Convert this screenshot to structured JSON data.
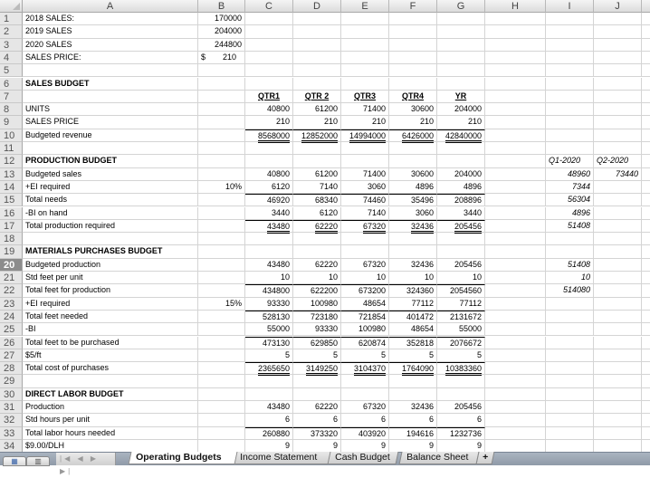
{
  "columns": [
    "A",
    "B",
    "C",
    "D",
    "E",
    "F",
    "G",
    "H",
    "I",
    "J"
  ],
  "rows": [
    {
      "n": "1",
      "A": "2018 SALES:",
      "B": "170000"
    },
    {
      "n": "2",
      "A": "2019 SALES",
      "B": "204000"
    },
    {
      "n": "3",
      "A": "2020 SALES",
      "B": "244800"
    },
    {
      "n": "4",
      "A": "SALES PRICE:",
      "B_dollar": "$",
      "B": "210"
    },
    {
      "n": "5"
    },
    {
      "n": "6",
      "A": "SALES BUDGET",
      "bold": true
    },
    {
      "n": "7",
      "C": "QTR1",
      "D": "QTR 2",
      "E": "QTR3",
      "F": "QTR4",
      "G": "YR",
      "hdr": true
    },
    {
      "n": "8",
      "A": "UNITS",
      "C": "40800",
      "D": "61200",
      "E": "71400",
      "F": "30600",
      "G": "204000"
    },
    {
      "n": "9",
      "A": "SALES PRICE",
      "C": "210",
      "D": "210",
      "E": "210",
      "F": "210",
      "G": "210"
    },
    {
      "n": "10",
      "A": "Budgeted revenue",
      "C": "8568000",
      "D": "12852000",
      "E": "14994000",
      "F": "6426000",
      "G": "42840000",
      "top": true,
      "dbl": true
    },
    {
      "n": "11"
    },
    {
      "n": "12",
      "A": "PRODUCTION BUDGET",
      "bold": true,
      "I": "Q1-2020",
      "J": "Q2-2020",
      "ijleft": true
    },
    {
      "n": "13",
      "A": "Budgeted sales",
      "C": "40800",
      "D": "61200",
      "E": "71400",
      "F": "30600",
      "G": "204000",
      "I": "48960",
      "J": "73440"
    },
    {
      "n": "14",
      "A": "+EI required",
      "B": "10%",
      "C": "6120",
      "D": "7140",
      "E": "3060",
      "F": "4896",
      "G": "4896",
      "I": "7344"
    },
    {
      "n": "15",
      "A": "Total needs",
      "C": "46920",
      "D": "68340",
      "E": "74460",
      "F": "35496",
      "G": "208896",
      "top": true,
      "I": "56304"
    },
    {
      "n": "16",
      "A": "-BI on hand",
      "C": "3440",
      "D": "6120",
      "E": "7140",
      "F": "3060",
      "G": "3440",
      "I": "4896"
    },
    {
      "n": "17",
      "A": "Total production required",
      "C": "43480",
      "D": "62220",
      "E": "67320",
      "F": "32436",
      "G": "205456",
      "top": true,
      "dbl": true,
      "I": "51408"
    },
    {
      "n": "18"
    },
    {
      "n": "19",
      "A": "MATERIALS PURCHASES BUDGET",
      "bold": true
    },
    {
      "n": "20",
      "A": "Budgeted production",
      "C": "43480",
      "D": "62220",
      "E": "67320",
      "F": "32436",
      "G": "205456",
      "I": "51408",
      "sel": true
    },
    {
      "n": "21",
      "A": "Std feet per unit",
      "C": "10",
      "D": "10",
      "E": "10",
      "F": "10",
      "G": "10",
      "I": "10"
    },
    {
      "n": "22",
      "A": "Total feet for production",
      "C": "434800",
      "D": "622200",
      "E": "673200",
      "F": "324360",
      "G": "2054560",
      "top": true,
      "I": "514080"
    },
    {
      "n": "23",
      "A": "+EI required",
      "B": "15%",
      "C": "93330",
      "D": "100980",
      "E": "48654",
      "F": "77112",
      "G": "77112"
    },
    {
      "n": "24",
      "A": "Total feet needed",
      "C": "528130",
      "D": "723180",
      "E": "721854",
      "F": "401472",
      "G": "2131672",
      "top": true
    },
    {
      "n": "25",
      "A": "-BI",
      "C": "55000",
      "D": "93330",
      "E": "100980",
      "F": "48654",
      "G": "55000"
    },
    {
      "n": "26",
      "A": "Total feet to be purchased",
      "C": "473130",
      "D": "629850",
      "E": "620874",
      "F": "352818",
      "G": "2076672",
      "top": true
    },
    {
      "n": "27",
      "A": "$5/ft",
      "C": "5",
      "D": "5",
      "E": "5",
      "F": "5",
      "G": "5"
    },
    {
      "n": "28",
      "A": "Total cost of purchases",
      "C": "2365650",
      "D": "3149250",
      "E": "3104370",
      "F": "1764090",
      "G": "10383360",
      "top": true,
      "dbl": true
    },
    {
      "n": "29"
    },
    {
      "n": "30",
      "A": "DIRECT LABOR BUDGET",
      "bold": true
    },
    {
      "n": "31",
      "A": "Production",
      "C": "43480",
      "D": "62220",
      "E": "67320",
      "F": "32436",
      "G": "205456"
    },
    {
      "n": "32",
      "A": "Std hours per unit",
      "C": "6",
      "D": "6",
      "E": "6",
      "F": "6",
      "G": "6"
    },
    {
      "n": "33",
      "A": "Total labor hours needed",
      "C": "260880",
      "D": "373320",
      "E": "403920",
      "F": "194616",
      "G": "1232736",
      "top": true
    },
    {
      "n": "34",
      "A": "$9.00/DLH",
      "C": "9",
      "D": "9",
      "E": "9",
      "F": "9",
      "G": "9"
    }
  ],
  "sheet_tabs": [
    {
      "label": "Operating Budgets",
      "active": true
    },
    {
      "label": "Income Statement"
    },
    {
      "label": "Cash Budget"
    },
    {
      "label": "Balance Sheet"
    }
  ],
  "add_sheet_label": "+",
  "nav_arrows": "|◀ ◀ ▶ ▶|",
  "view_buttons": [
    "normal-view",
    "page-layout-view"
  ]
}
